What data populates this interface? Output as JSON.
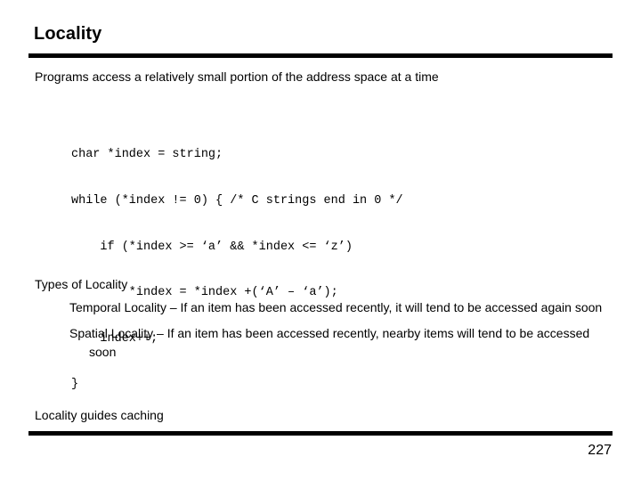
{
  "slide": {
    "title": "Locality",
    "intro_line": "Programs access a relatively small portion of the address space at a time",
    "code": {
      "language": "c",
      "lines": [
        "char *index = string;",
        "while (*index != 0) { /* C strings end in 0 */",
        "    if (*index >= ‘a’ && *index <= ‘z’)",
        "        *index = *index +(‘A’ – ‘a’);",
        "    index++;",
        "}"
      ]
    },
    "types_heading": "Types of Locality",
    "bullets": [
      "Temporal Locality – If an item has been accessed recently, it will tend to be accessed again soon",
      "Spatial Locality – If an item has been accessed recently, nearby items will tend to be accessed soon"
    ],
    "closing_line": "Locality guides caching",
    "page_number": "227",
    "colors": {
      "background": "#ffffff",
      "text": "#000000",
      "rule": "#000000"
    }
  }
}
